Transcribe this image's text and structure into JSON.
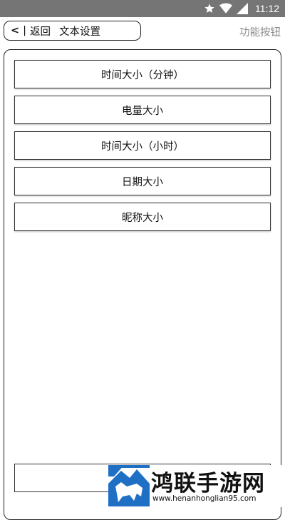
{
  "status_bar": {
    "time": "11:12",
    "icons": [
      "star-icon",
      "wifi-icon",
      "signal-icon"
    ]
  },
  "header": {
    "back_chevron": "<",
    "separator": "|",
    "back_label": "返回",
    "title": "文本设置",
    "function_button": "功能按钮"
  },
  "settings_list": {
    "items": [
      {
        "label": "时间大小（分钟）"
      },
      {
        "label": "电量大小"
      },
      {
        "label": "时间大小（小时）"
      },
      {
        "label": "日期大小"
      },
      {
        "label": "昵称大小"
      }
    ],
    "bottom_button_label": ""
  },
  "watermark": {
    "title": "鸿联手游网",
    "url": "www.henanhonglian95.com",
    "logo": "bull-mountain-logo"
  },
  "colors": {
    "status_bar": "#757575",
    "function_button_text": "#8a8a8a",
    "border": "#222222",
    "logo_blue": "#1f6fc5"
  }
}
